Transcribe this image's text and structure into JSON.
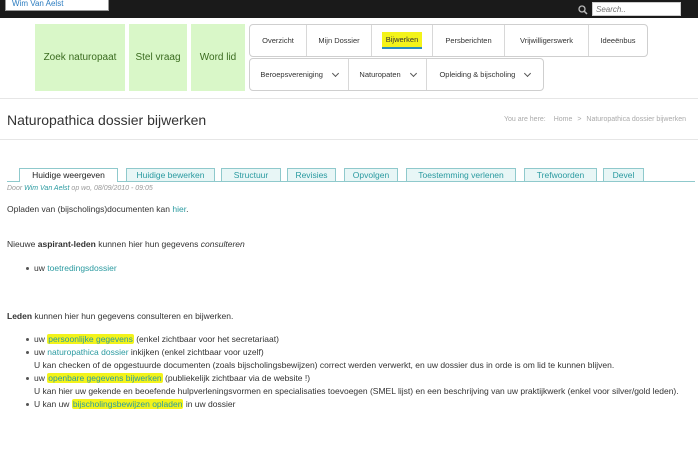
{
  "topbar": {
    "user_name": "Wim Van Aelst",
    "search_placeholder": "Search.."
  },
  "quick_links": [
    {
      "label": "Zoek naturopaat"
    },
    {
      "label": "Stel vraag"
    },
    {
      "label": "Word lid"
    }
  ],
  "nav": {
    "row1": [
      "Overzicht",
      "Mijn Dossier",
      "Bijwerken",
      "Persberichten",
      "Vrijwilligerswerk",
      "Ideeënbus"
    ],
    "row2": [
      "Beroepsvereniging",
      "Naturopaten",
      "Opleiding & bijscholing"
    ]
  },
  "page": {
    "title": "Naturopathica dossier bijwerken",
    "breadcrumb_prefix": "You are here:",
    "breadcrumb_home": "Home",
    "breadcrumb_current": "Naturopathica dossier bijwerken"
  },
  "tabs": [
    "Huidige weergeven",
    "Huidige bewerken",
    "Structuur",
    "Revisies",
    "Opvolgen",
    "Toestemming verlenen",
    "Trefwoorden",
    "Devel"
  ],
  "meta": {
    "prefix": "Door",
    "author": "Wim Van Aelst",
    "date": "op wo, 08/09/2010 - 09:05"
  },
  "body": {
    "p1_text": "Opladen van (bijscholings)documenten kan",
    "p1_link": "hier",
    "p1_end": ".",
    "p2_a": "Nieuwe",
    "p2_bold": "aspirant-leden",
    "p2_b": "kunnen hier hun gegevens",
    "p2_italic": "consulteren",
    "b1_pre": "uw",
    "b1_link": "toetredingsdossier",
    "p3_bold": "Leden",
    "p3_text": "kunnen hier hun gegevens consulteren en bijwerken.",
    "items": [
      {
        "pre": "uw",
        "link": "persoonlijke gegevens",
        "post": "(enkel zichtbaar voor het secretariaat)"
      },
      {
        "pre": "uw",
        "link": "naturopathica dossier",
        "post": "inkijken (enkel zichtbaar voor uzelf)",
        "extra": "U kan checken of de opgestuurde documenten (zoals bijscholingsbewijzen) correct werden verwerkt, en uw dossier dus in orde is om lid te kunnen blijven."
      },
      {
        "pre": "uw",
        "link": "openbare gegevens bijwerken",
        "post": "(publiekelijk zichtbaar via de website !)",
        "extra": "U kan hier uw gekende en beoefende hulpverleningsvormen en specialisaties toevoegen (SMEL lijst) en een beschrijving van uw praktijkwerk (enkel voor silver/gold leden)."
      },
      {
        "pre": "U kan uw",
        "link": "bijscholingsbewijzen opladen",
        "post": "in uw dossier"
      }
    ]
  }
}
